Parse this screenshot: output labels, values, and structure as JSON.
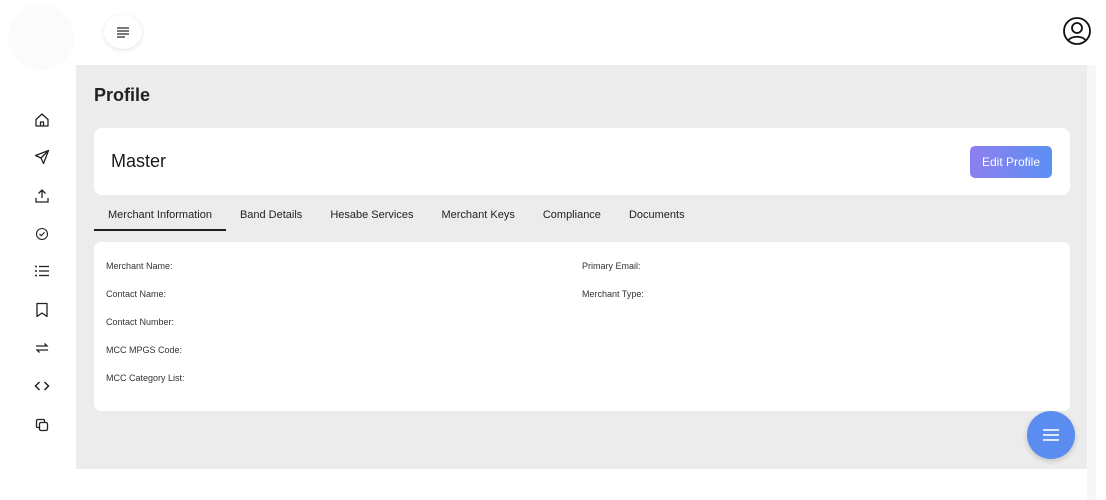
{
  "header": {
    "menu_icon": "hamburger-menu-icon",
    "user_icon": "user-circle-icon"
  },
  "sidebar": {
    "items": [
      {
        "name": "home",
        "icon": "home-icon"
      },
      {
        "name": "send",
        "icon": "send-icon"
      },
      {
        "name": "upload",
        "icon": "upload-icon"
      },
      {
        "name": "check",
        "icon": "check-circle-icon"
      },
      {
        "name": "list",
        "icon": "list-icon"
      },
      {
        "name": "bookmark",
        "icon": "bookmark-icon"
      },
      {
        "name": "transfer",
        "icon": "transfer-arrows-icon"
      },
      {
        "name": "code",
        "icon": "code-icon"
      },
      {
        "name": "copy",
        "icon": "copy-icon"
      }
    ]
  },
  "page": {
    "title": "Profile"
  },
  "master": {
    "name": "Master",
    "edit_label": "Edit Profile"
  },
  "tabs": [
    {
      "label": "Merchant Information",
      "active": true
    },
    {
      "label": "Band Details",
      "active": false
    },
    {
      "label": "Hesabe Services",
      "active": false
    },
    {
      "label": "Merchant Keys",
      "active": false
    },
    {
      "label": "Compliance",
      "active": false
    },
    {
      "label": "Documents",
      "active": false
    }
  ],
  "merchant_info": {
    "left": [
      "Merchant Name:",
      "Contact Name:",
      "Contact Number:",
      "MCC MPGS Code:",
      "MCC Category List:"
    ],
    "right": [
      "Primary Email:",
      "Merchant Type:"
    ]
  },
  "fab": {
    "icon": "menu-icon"
  },
  "colors": {
    "accent": "#5b8cf0",
    "button_gradient_start": "#8d7ff0",
    "button_gradient_end": "#5d8ff2",
    "content_bg": "#ececec"
  }
}
